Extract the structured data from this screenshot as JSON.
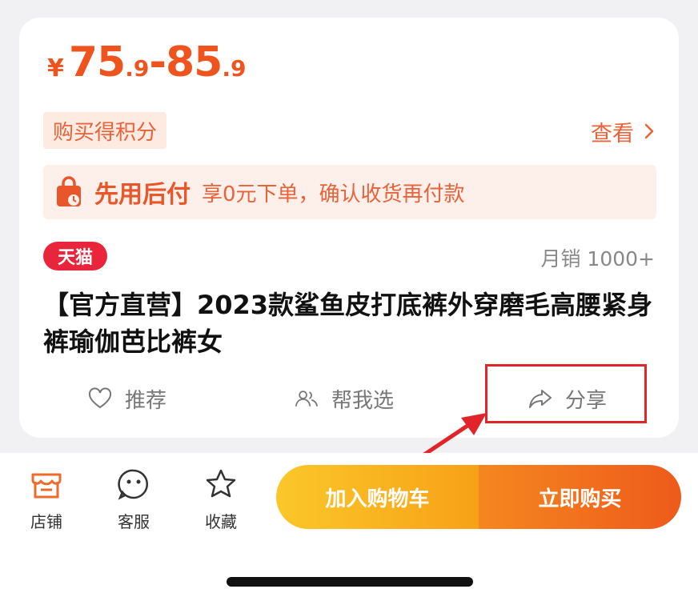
{
  "price": {
    "currency": "¥",
    "min_major": "75",
    "min_minor": ".9",
    "separator": "-",
    "max_major": "85",
    "max_minor": ".9"
  },
  "points": {
    "tag": "购买得积分",
    "view_label": "查看"
  },
  "pay_later": {
    "title": "先用后付",
    "desc": "享0元下单，确认收货再付款"
  },
  "product": {
    "badge": "天猫",
    "sales": "月销 1000+",
    "title": "【官方直营】2023款鲨鱼皮打底裤外穿磨毛高腰紧身裤瑜伽芭比裤女"
  },
  "actions": [
    {
      "label": "推荐",
      "icon": "heart-icon"
    },
    {
      "label": "帮我选",
      "icon": "people-icon"
    },
    {
      "label": "分享",
      "icon": "share-arrow-icon"
    }
  ],
  "bottom_nav": [
    {
      "label": "店铺",
      "icon": "store-icon"
    },
    {
      "label": "客服",
      "icon": "service-face-icon"
    },
    {
      "label": "收藏",
      "icon": "star-icon"
    }
  ],
  "buttons": {
    "add_to_cart": "加入购物车",
    "buy_now": "立即购买"
  },
  "colors": {
    "price": "#f0541e",
    "accent": "#e8623a",
    "tmall_red": "#e8253b",
    "highlight": "#e0242a",
    "cart_button": "#f9b420",
    "buy_button": "#f0661c"
  }
}
